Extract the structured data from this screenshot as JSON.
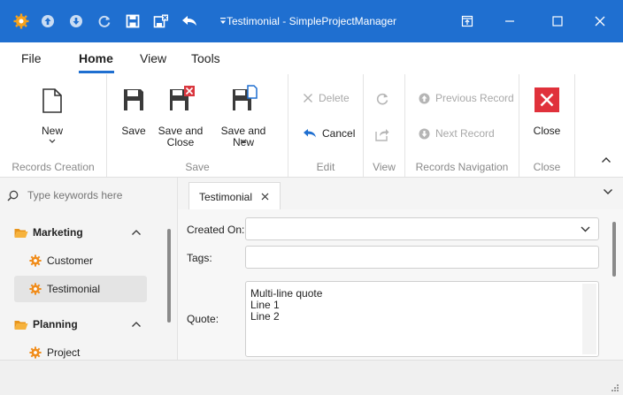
{
  "window": {
    "title": "Testimonial - SimpleProjectManager",
    "accent": "#1f6fd0",
    "quick_access_icons": [
      "app-gear-icon",
      "arrow-up-circle-icon",
      "arrow-down-circle-icon",
      "refresh-icon",
      "save-icon",
      "save-close-icon",
      "undo-arrow-icon",
      "customize-dropdown-icon"
    ],
    "controls": [
      "restore-icon",
      "maximize-icon",
      "close-icon"
    ]
  },
  "menu": {
    "tabs": [
      {
        "label": "File"
      },
      {
        "label": "Home"
      },
      {
        "label": "View"
      },
      {
        "label": "Tools"
      }
    ],
    "active_tab": "Home"
  },
  "ribbon": {
    "groups": {
      "records_creation": {
        "label": "Records Creation",
        "new_label": "New"
      },
      "save": {
        "label": "Save",
        "save_label": "Save",
        "save_close_label_1": "Save and",
        "save_close_label_2": "Close",
        "save_new_label": "Save and New"
      },
      "edit": {
        "label": "Edit",
        "delete_label": "Delete",
        "cancel_label": "Cancel"
      },
      "view": {
        "label": "View"
      },
      "records_navigation": {
        "label": "Records Navigation",
        "previous_label": "Previous Record",
        "next_label": "Next Record"
      },
      "close": {
        "label": "Close",
        "close_label": "Close"
      }
    }
  },
  "nav": {
    "search_placeholder": "Type keywords here",
    "groups": [
      {
        "label": "Marketing",
        "items": [
          {
            "label": "Customer"
          },
          {
            "label": "Testimonial",
            "selected": true
          }
        ]
      },
      {
        "label": "Planning",
        "items": [
          {
            "label": "Project"
          }
        ]
      }
    ]
  },
  "doc_tabs": [
    {
      "label": "Testimonial"
    }
  ],
  "form": {
    "created_on_label": "Created On:",
    "created_on_value": "",
    "tags_label": "Tags:",
    "tags_value": "",
    "quote_label": "Quote:",
    "quote_lines": [
      "Multi-line quote",
      "Line 1",
      "Line 2"
    ]
  }
}
